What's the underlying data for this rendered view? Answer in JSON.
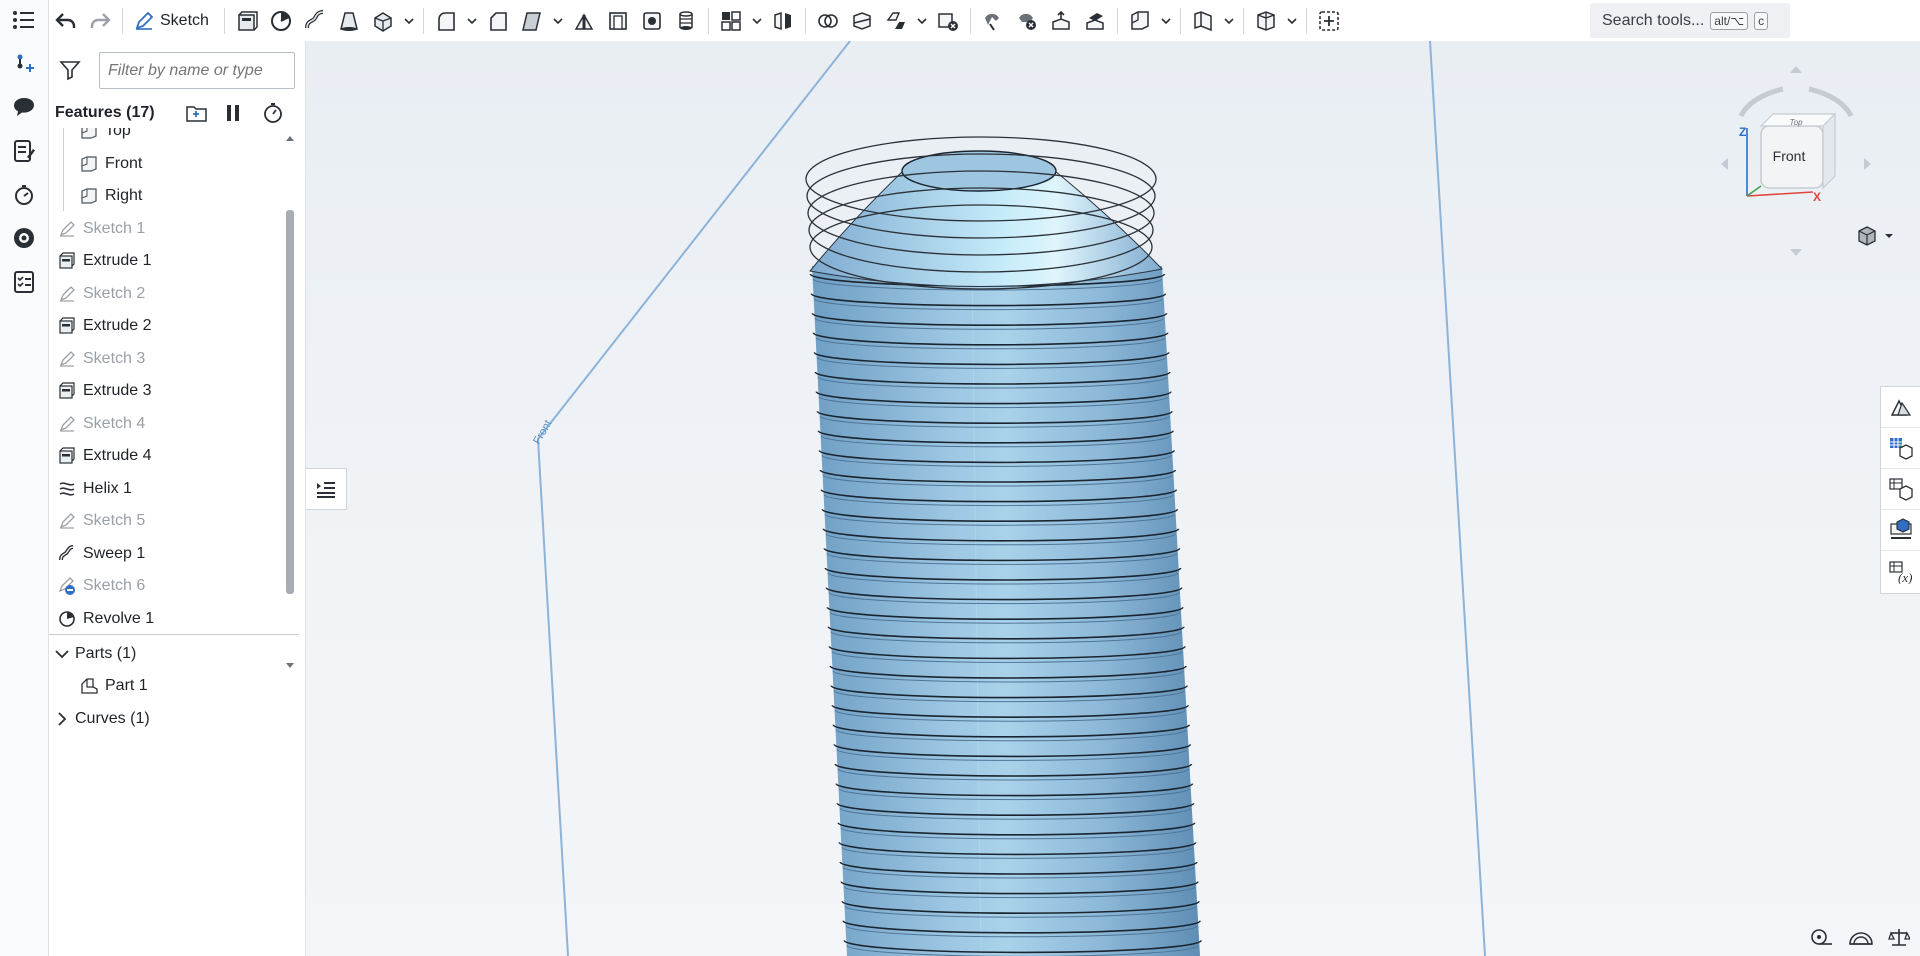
{
  "toolbar": {
    "sketch_label": "Sketch",
    "search_label": "Search tools...",
    "search_shortcut_mod": "alt/⌥",
    "search_shortcut_key": "c"
  },
  "panel": {
    "filter_placeholder": "Filter by name or type",
    "features_title": "Features (17)",
    "features": [
      {
        "label": "Top",
        "icon": "plane-icon",
        "dim": false
      },
      {
        "label": "Front",
        "icon": "plane-icon",
        "dim": false
      },
      {
        "label": "Right",
        "icon": "plane-icon",
        "dim": false
      },
      {
        "label": "Sketch 1",
        "icon": "sketch-icon",
        "dim": true
      },
      {
        "label": "Extrude 1",
        "icon": "extrude-icon",
        "dim": false
      },
      {
        "label": "Sketch 2",
        "icon": "sketch-icon",
        "dim": true
      },
      {
        "label": "Extrude 2",
        "icon": "extrude-icon",
        "dim": false
      },
      {
        "label": "Sketch 3",
        "icon": "sketch-icon",
        "dim": true
      },
      {
        "label": "Extrude 3",
        "icon": "extrude-icon",
        "dim": false
      },
      {
        "label": "Sketch 4",
        "icon": "sketch-icon",
        "dim": true
      },
      {
        "label": "Extrude 4",
        "icon": "extrude-icon",
        "dim": false
      },
      {
        "label": "Helix 1",
        "icon": "helix-icon",
        "dim": false
      },
      {
        "label": "Sketch 5",
        "icon": "sketch-icon",
        "dim": true
      },
      {
        "label": "Sweep 1",
        "icon": "sweep-icon",
        "dim": false
      },
      {
        "label": "Sketch 6",
        "icon": "sketch-error-icon",
        "dim": true
      },
      {
        "label": "Revolve 1",
        "icon": "revolve-icon",
        "dim": false
      }
    ],
    "parts_label": "Parts (1)",
    "part_item": "Part 1",
    "curves_label": "Curves (1)"
  },
  "viewcube": {
    "face_label": "Front",
    "top_label": "Top",
    "axis_z": "Z",
    "axis_x": "X"
  },
  "colors": {
    "accent": "#2f6ec5",
    "part_blue": "#8fb9d8",
    "thread_line": "#1b2530",
    "plane_edge": "#8db3d9"
  }
}
